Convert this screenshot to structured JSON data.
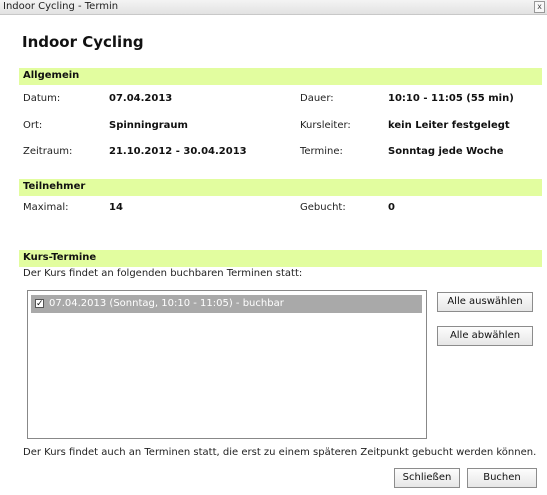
{
  "window": {
    "title": "Indoor Cycling - Termin",
    "close_label": "x"
  },
  "heading": "Indoor Cycling",
  "allgemein": {
    "title": "Allgemein",
    "datum_label": "Datum:",
    "datum_value": "07.04.2013",
    "dauer_label": "Dauer:",
    "dauer_value": "10:10 - 11:05 (55 min)",
    "ort_label": "Ort:",
    "ort_value": "Spinningraum",
    "kursleiter_label": "Kursleiter:",
    "kursleiter_value": "kein Leiter festgelegt",
    "zeitraum_label": "Zeitraum:",
    "zeitraum_value": "21.10.2012 - 30.04.2013",
    "termine_label": "Termine:",
    "termine_value": "Sonntag jede Woche"
  },
  "teilnehmer": {
    "title": "Teilnehmer",
    "maximal_label": "Maximal:",
    "maximal_value": "14",
    "gebucht_label": "Gebucht:",
    "gebucht_value": "0"
  },
  "kurs_termine": {
    "title": "Kurs-Termine",
    "intro": "Der Kurs findet an folgenden buchbaren Terminen statt:",
    "items": [
      {
        "label": "07.04.2013 (Sonntag, 10:10 - 11:05) - buchbar",
        "checked": true
      }
    ],
    "select_all": "Alle auswählen",
    "deselect_all": "Alle abwählen",
    "footnote": "Der Kurs findet auch an Terminen statt, die erst zu einem späteren Zeitpunkt gebucht werden können."
  },
  "footer": {
    "close_label": "Schließen",
    "book_label": "Buchen"
  }
}
